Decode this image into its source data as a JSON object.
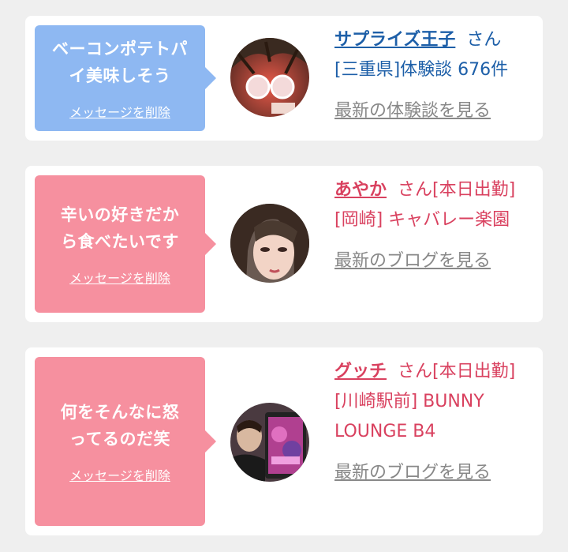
{
  "cards": [
    {
      "message": "ベーコンポテトパイ美味しそう",
      "delete_label": "メッセージを削除",
      "name": "サプライズ王子",
      "honorific": "さん",
      "detail": "[三重県]体験談 676件",
      "latest_link": "最新の体験談を見る",
      "bubble_color": "#8eb8f2",
      "text_color": "#1d5fa8"
    },
    {
      "message": "辛いの好きだから食べたいです",
      "delete_label": "メッセージを削除",
      "name": "あやか",
      "honorific": "さん[本日出勤]",
      "detail": "[岡崎] キャバレー楽園",
      "latest_link": "最新のブログを見る",
      "bubble_color": "#f6909f",
      "text_color": "#d9415f"
    },
    {
      "message": "何をそんなに怒ってるのだ笑",
      "delete_label": "メッセージを削除",
      "name": "グッチ",
      "honorific": "さん[本日出勤]",
      "detail": "[川崎駅前] BUNNY LOUNGE B4",
      "latest_link": "最新のブログを見る",
      "bubble_color": "#f6909f",
      "text_color": "#d9415f"
    }
  ]
}
